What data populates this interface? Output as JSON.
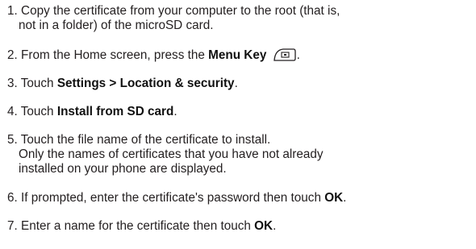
{
  "steps": [
    {
      "num": "1.",
      "line1": "Copy the certificate from your computer to the root (that is,",
      "line2": "not in a folder) of the microSD card."
    },
    {
      "num": "2.",
      "pre": "From the Home screen, press the ",
      "bold": "Menu Key",
      "icon": "menu-key-icon",
      "post": "."
    },
    {
      "num": "3.",
      "pre": "Touch ",
      "bold": "Settings > Location & security",
      "post": "."
    },
    {
      "num": "4.",
      "pre": "Touch ",
      "bold": "Install from SD card",
      "post": "."
    },
    {
      "num": "5.",
      "line1": "Touch the file name of the certificate to install.",
      "line2": "Only the names of certificates that you have not already",
      "line3": "installed on your phone are displayed."
    },
    {
      "num": "6.",
      "pre": "If prompted, enter the certificate's password then touch ",
      "bold": "OK",
      "post": "."
    },
    {
      "num": "7.",
      "pre": "Enter a name for the certificate then touch ",
      "bold": "OK",
      "post": "."
    }
  ]
}
